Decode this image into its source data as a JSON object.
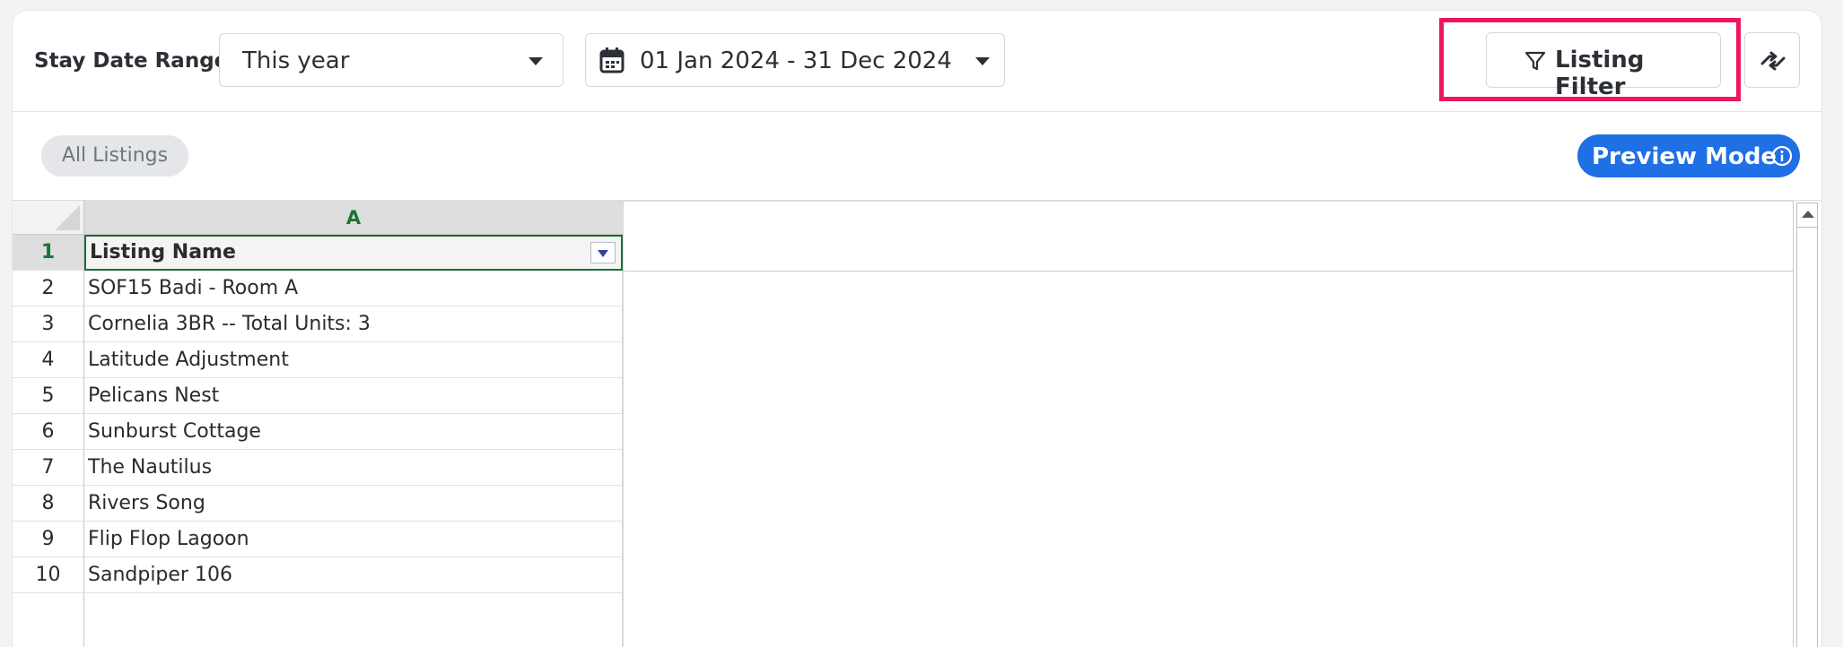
{
  "toolbar": {
    "stay_date_label": "Stay Date Range",
    "period_select": {
      "value": "This year"
    },
    "date_range_select": {
      "value": "01 Jan 2024 - 31 Dec 2024"
    },
    "listing_filter_label": "Listing Filter",
    "highlight_color": "#ee1560"
  },
  "filters": {
    "chip_label": "All Listings",
    "preview_label": "Preview Mode",
    "preview_color": "#1f6fe5"
  },
  "sheet": {
    "column_header": "A",
    "rows": [
      {
        "num": "1",
        "value": "Listing Name"
      },
      {
        "num": "2",
        "value": "SOF15 Badi - Room A"
      },
      {
        "num": "3",
        "value": "Cornelia 3BR -- Total Units: 3"
      },
      {
        "num": "4",
        "value": "Latitude Adjustment"
      },
      {
        "num": "5",
        "value": "Pelicans Nest"
      },
      {
        "num": "6",
        "value": "Sunburst Cottage"
      },
      {
        "num": "7",
        "value": "The Nautilus"
      },
      {
        "num": "8",
        "value": "Rivers Song"
      },
      {
        "num": "9",
        "value": "Flip Flop Lagoon"
      },
      {
        "num": "10",
        "value": "Sandpiper 106"
      }
    ]
  }
}
